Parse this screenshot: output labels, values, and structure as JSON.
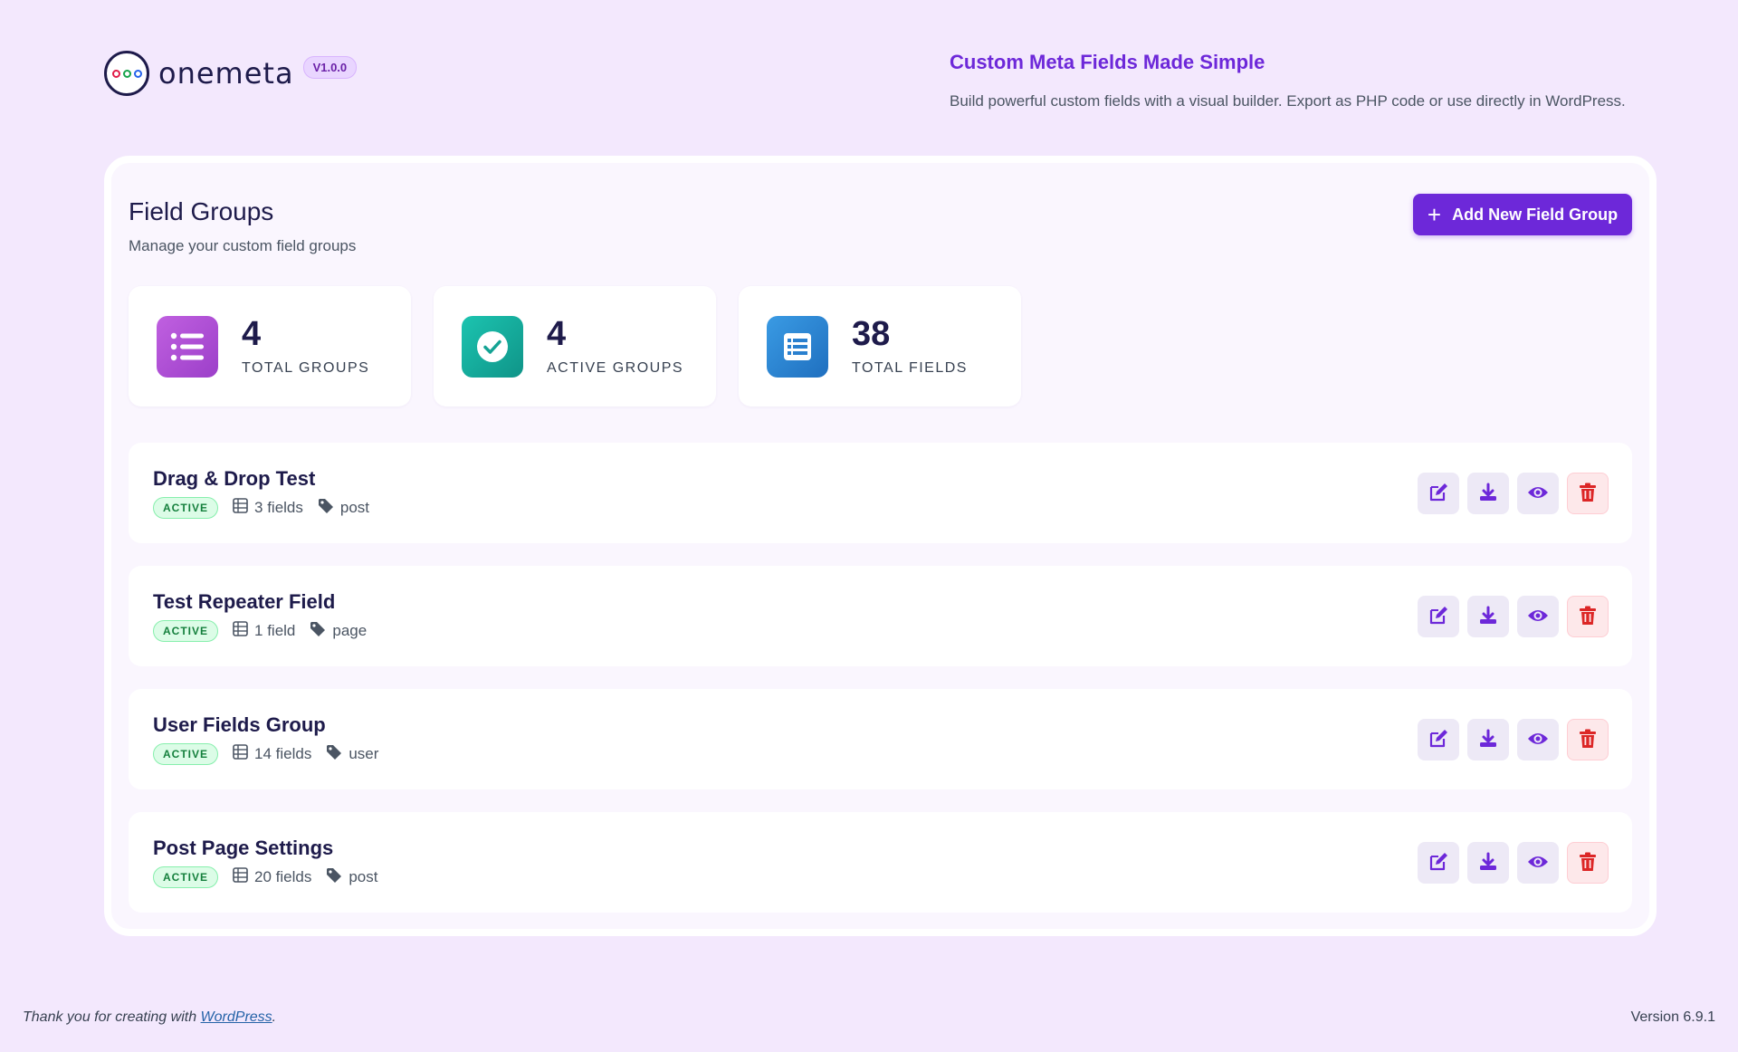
{
  "brand": {
    "logo_text": "onemeta",
    "version": "V1.0.0"
  },
  "tagline": {
    "title": "Custom Meta Fields Made Simple",
    "description": "Build powerful custom fields with a visual builder. Export as PHP code or use directly in WordPress."
  },
  "section": {
    "title": "Field Groups",
    "subtitle": "Manage your custom field groups",
    "add_button_label": "Add New Field Group"
  },
  "stats": [
    {
      "value": "4",
      "label": "TOTAL GROUPS",
      "icon": "list-icon",
      "color": "#b84fd6"
    },
    {
      "value": "4",
      "label": "ACTIVE GROUPS",
      "icon": "check-circle-icon",
      "color": "#14b8a6"
    },
    {
      "value": "38",
      "label": "TOTAL FIELDS",
      "icon": "table-list-icon",
      "color": "#2a86d6"
    }
  ],
  "field_groups": [
    {
      "name": "Drag & Drop Test",
      "status": "ACTIVE",
      "fields": "3 fields",
      "location": "post"
    },
    {
      "name": "Test Repeater Field",
      "status": "ACTIVE",
      "fields": "1 field",
      "location": "page"
    },
    {
      "name": "User Fields Group",
      "status": "ACTIVE",
      "fields": "14 fields",
      "location": "user"
    },
    {
      "name": "Post Page Settings",
      "status": "ACTIVE",
      "fields": "20 fields",
      "location": "post"
    }
  ],
  "row_actions": [
    "edit-icon",
    "download-icon",
    "eye-icon",
    "trash-icon"
  ],
  "footer": {
    "thanks_prefix": "Thank you for creating with ",
    "thanks_link": "WordPress",
    "thanks_suffix": ".",
    "version": "Version 6.9.1"
  },
  "colors": {
    "accent": "#6d28d9",
    "background": "#f3e8fd",
    "active_badge": "#15803d",
    "danger": "#dc2626"
  }
}
